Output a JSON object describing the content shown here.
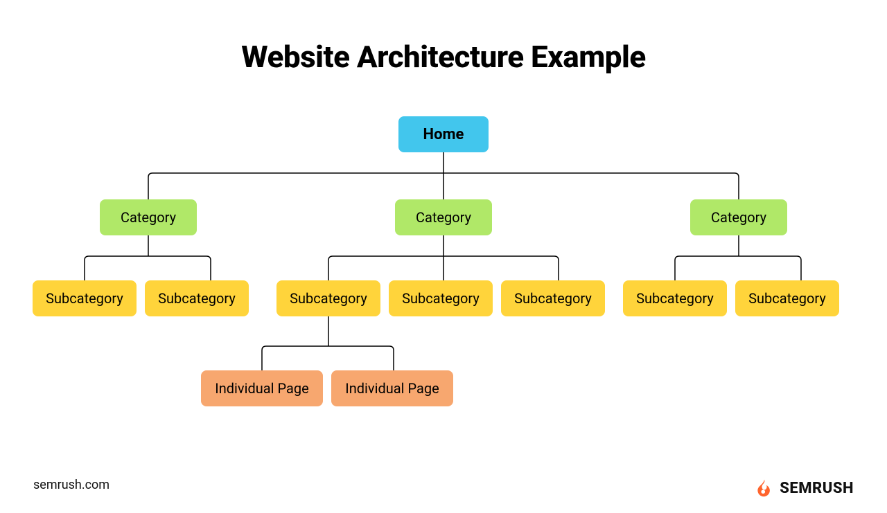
{
  "title": "Website Architecture Example",
  "nodes": {
    "home": "Home",
    "category": "Category",
    "subcategory": "Subcategory",
    "individual_page": "Individual Page"
  },
  "footer": {
    "url": "semrush.com",
    "brand": "SEMRUSH"
  },
  "colors": {
    "home": "#42c6ed",
    "category": "#b0e868",
    "subcategory": "#ffd43b",
    "individual_page": "#f7a76f",
    "brand_accent": "#ff642d"
  },
  "structure": {
    "root": "Home",
    "children": [
      {
        "label": "Category",
        "children": [
          {
            "label": "Subcategory"
          },
          {
            "label": "Subcategory"
          }
        ]
      },
      {
        "label": "Category",
        "children": [
          {
            "label": "Subcategory",
            "children": [
              {
                "label": "Individual Page"
              },
              {
                "label": "Individual Page"
              }
            ]
          },
          {
            "label": "Subcategory"
          },
          {
            "label": "Subcategory"
          }
        ]
      },
      {
        "label": "Category",
        "children": [
          {
            "label": "Subcategory"
          },
          {
            "label": "Subcategory"
          }
        ]
      }
    ]
  }
}
